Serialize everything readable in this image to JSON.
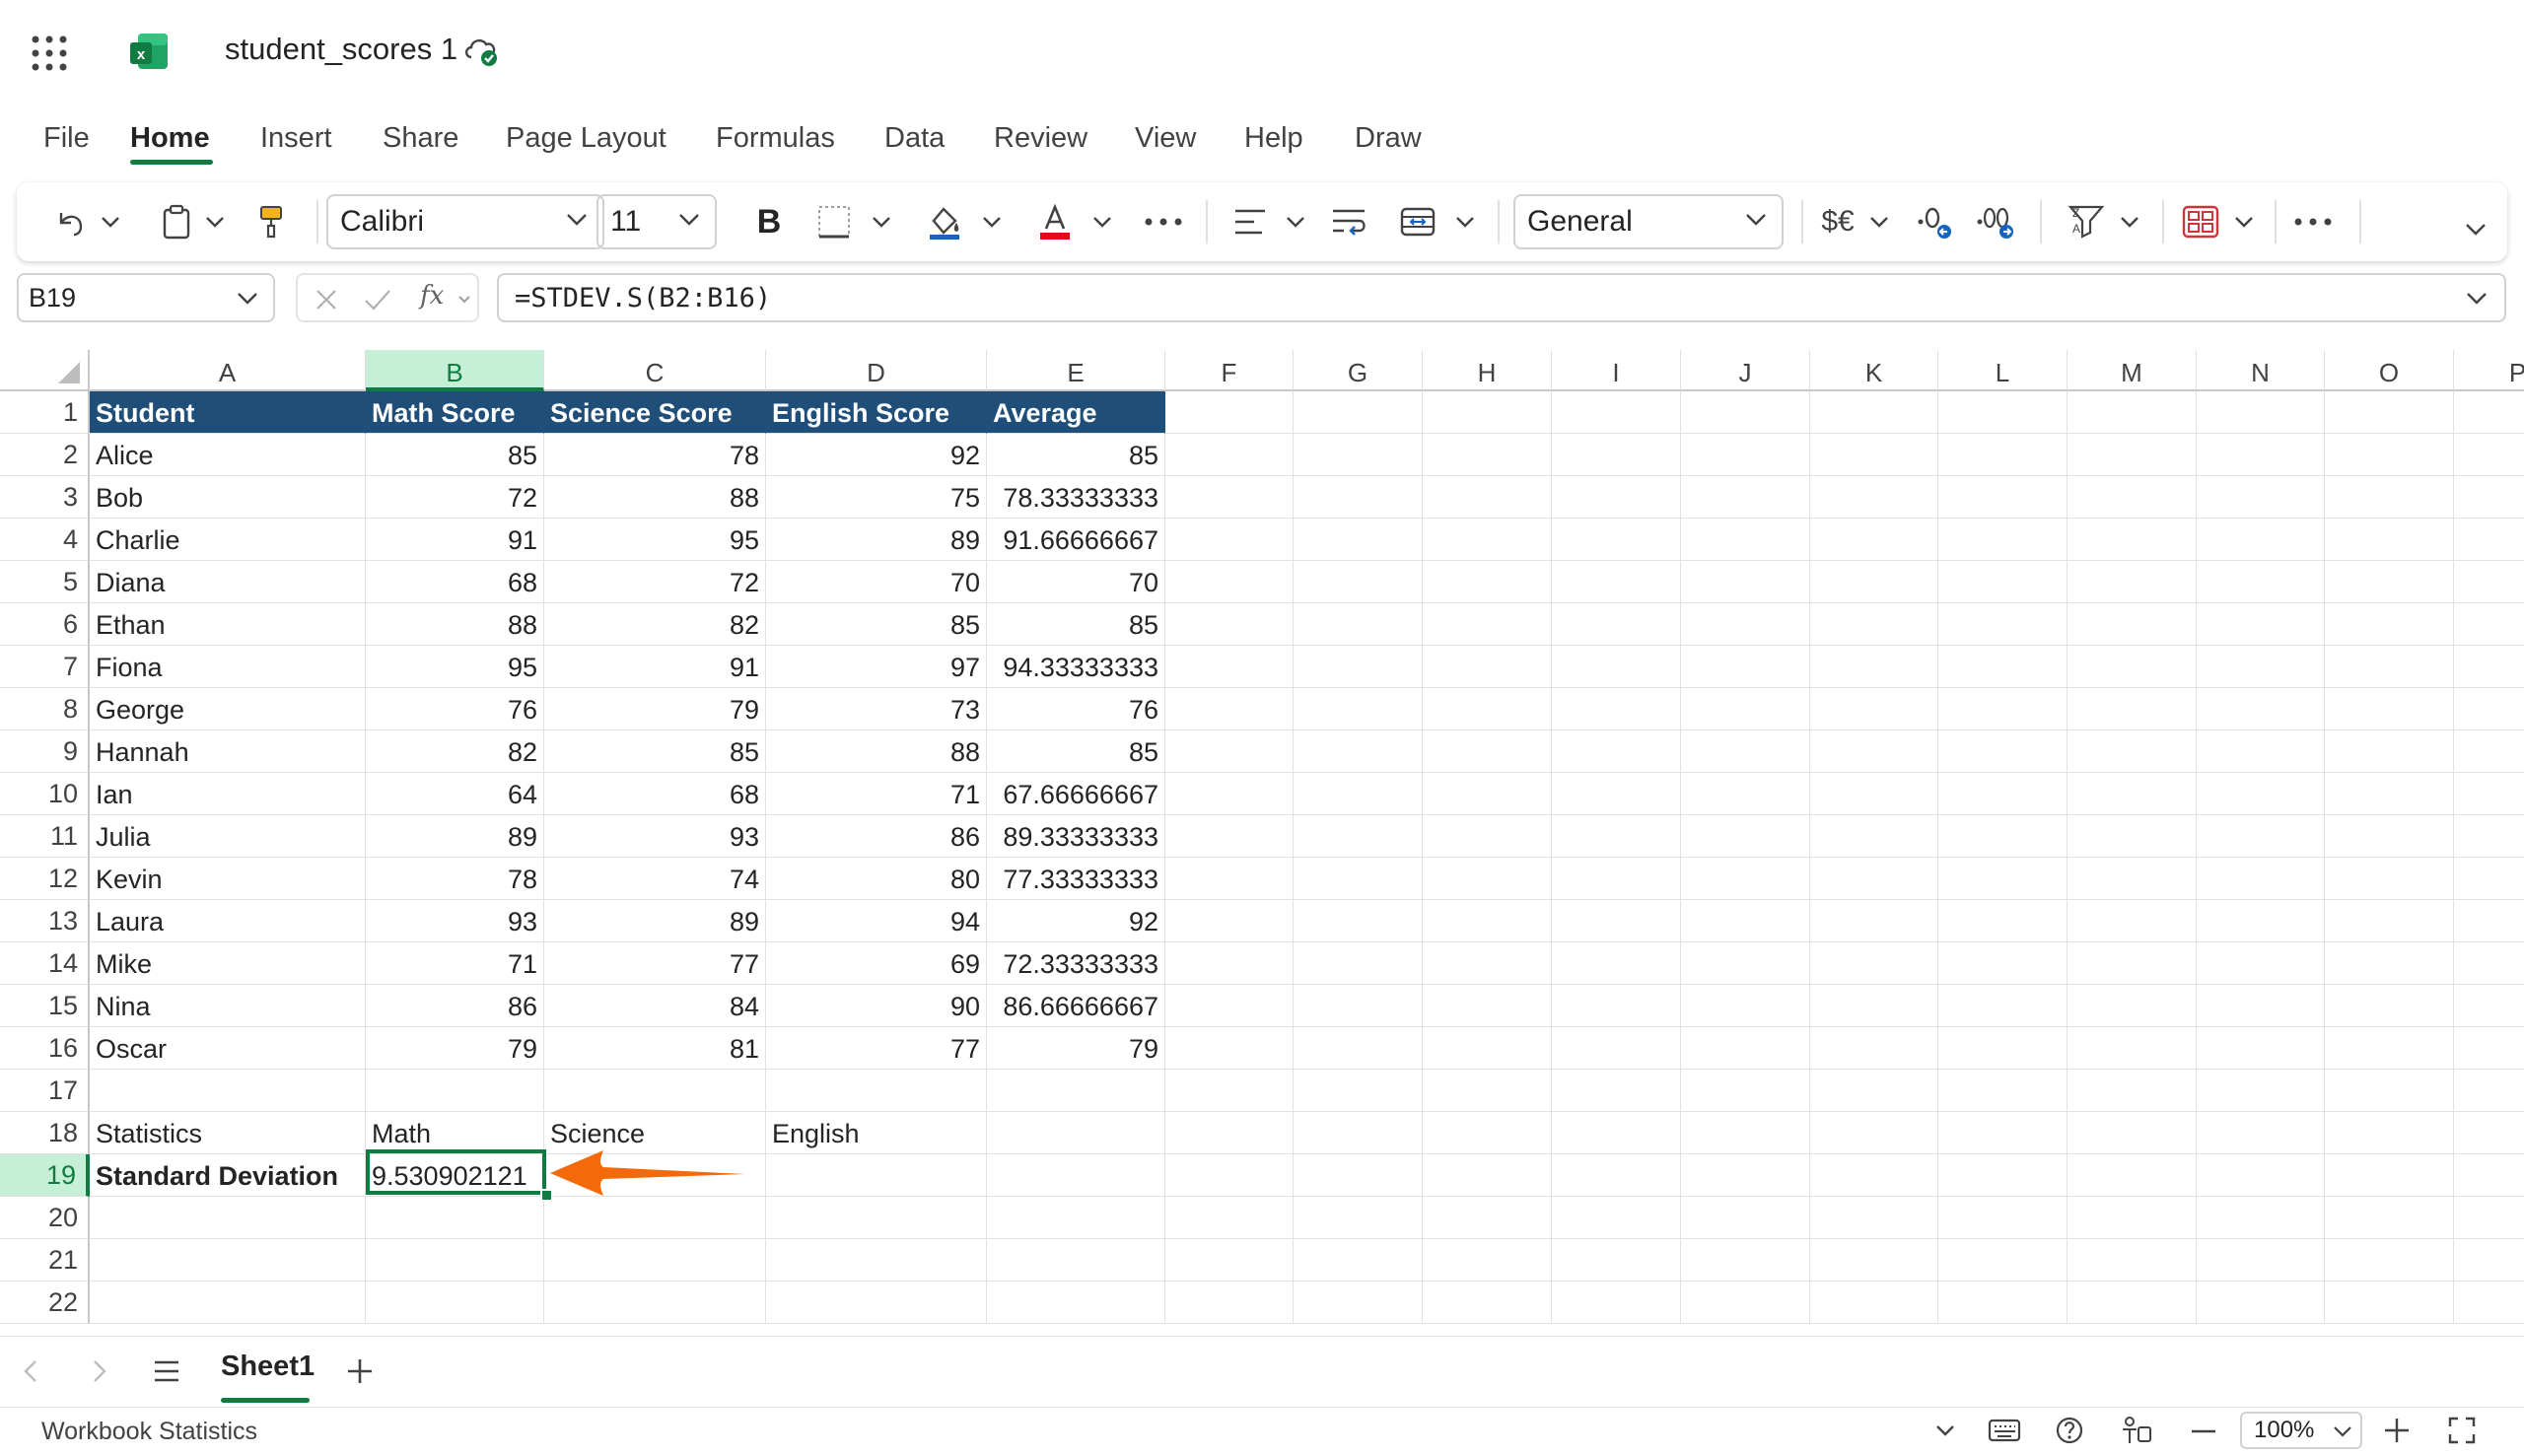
{
  "app": {
    "title": "student_scores 1",
    "icons": [
      "app-launcher-icon",
      "excel-logo",
      "cloud-saved-icon"
    ]
  },
  "menu": {
    "tabs": [
      "File",
      "Home",
      "Insert",
      "Share",
      "Page Layout",
      "Formulas",
      "Data",
      "Review",
      "View",
      "Help",
      "Draw"
    ],
    "active": "Home"
  },
  "ribbon": {
    "font_name": "Calibri",
    "font_size": "11",
    "number_format": "General",
    "bold_label": "B",
    "currency_label": "$€"
  },
  "formula_bar": {
    "name_box": "B19",
    "fx_label": "fx",
    "formula": "=STDEV.S(B2:B16)"
  },
  "grid": {
    "columns": [
      "A",
      "B",
      "C",
      "D",
      "E",
      "F",
      "G",
      "H",
      "I",
      "J",
      "K",
      "L",
      "M",
      "N",
      "O",
      "P"
    ],
    "selected_column": "B",
    "selected_row": "19",
    "rows": [
      "1",
      "2",
      "3",
      "4",
      "5",
      "6",
      "7",
      "8",
      "9",
      "10",
      "11",
      "12",
      "13",
      "14",
      "15",
      "16",
      "17",
      "18",
      "19",
      "20",
      "21",
      "22"
    ],
    "header": [
      "Student",
      "Math Score",
      "Science Score",
      "English Score",
      "Average"
    ],
    "data": [
      [
        "Alice",
        "85",
        "78",
        "92",
        "85"
      ],
      [
        "Bob",
        "72",
        "88",
        "75",
        "78.33333333"
      ],
      [
        "Charlie",
        "91",
        "95",
        "89",
        "91.66666667"
      ],
      [
        "Diana",
        "68",
        "72",
        "70",
        "70"
      ],
      [
        "Ethan",
        "88",
        "82",
        "85",
        "85"
      ],
      [
        "Fiona",
        "95",
        "91",
        "97",
        "94.33333333"
      ],
      [
        "George",
        "76",
        "79",
        "73",
        "76"
      ],
      [
        "Hannah",
        "82",
        "85",
        "88",
        "85"
      ],
      [
        "Ian",
        "64",
        "68",
        "71",
        "67.66666667"
      ],
      [
        "Julia",
        "89",
        "93",
        "86",
        "89.33333333"
      ],
      [
        "Kevin",
        "78",
        "74",
        "80",
        "77.33333333"
      ],
      [
        "Laura",
        "93",
        "89",
        "94",
        "92"
      ],
      [
        "Mike",
        "71",
        "77",
        "69",
        "72.33333333"
      ],
      [
        "Nina",
        "86",
        "84",
        "90",
        "86.66666667"
      ],
      [
        "Oscar",
        "79",
        "81",
        "77",
        "79"
      ]
    ],
    "stats_row": [
      "Statistics",
      "Math",
      "Science",
      "English"
    ],
    "stddev_row": [
      "Standard Deviation",
      "9.530902121"
    ]
  },
  "sheets": {
    "active": "Sheet1"
  },
  "status": {
    "label": "Workbook Statistics",
    "zoom": "100%"
  },
  "colors": {
    "accent": "#107c41",
    "header_fill": "#1f4e79",
    "arrow": "#f46a0a"
  }
}
